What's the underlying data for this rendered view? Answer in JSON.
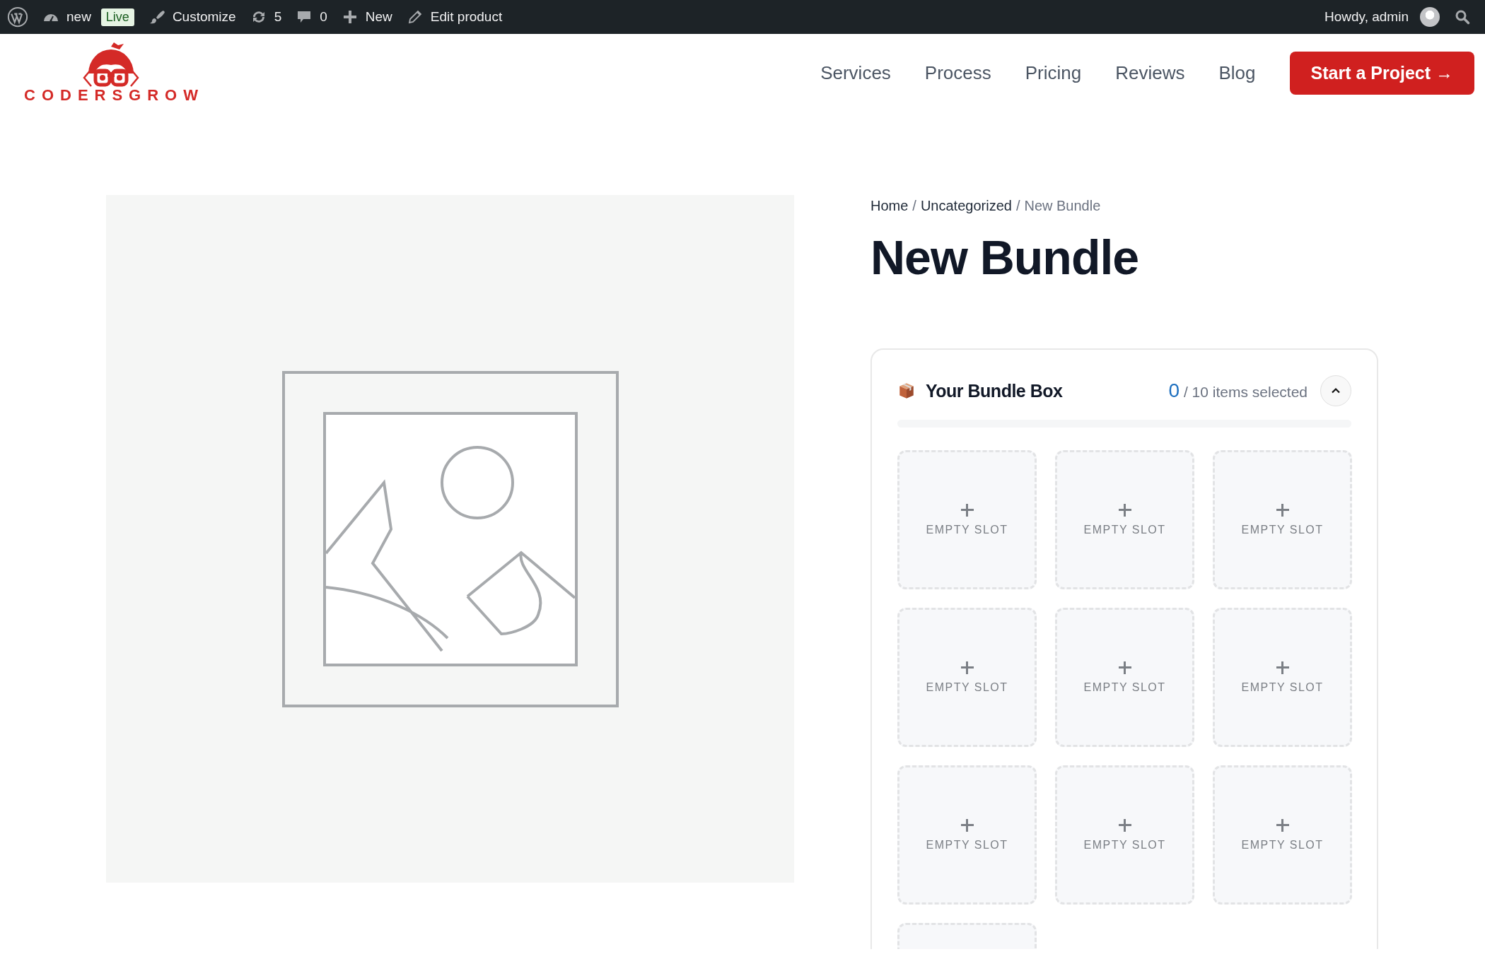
{
  "admin_bar": {
    "items": [
      {
        "kind": "wp-logo"
      },
      {
        "kind": "dashboard",
        "label": "new"
      },
      {
        "kind": "badge",
        "label": "Live"
      },
      {
        "kind": "brush",
        "label": "Customize"
      },
      {
        "kind": "updates",
        "label": "5"
      },
      {
        "kind": "comments",
        "label": "0"
      },
      {
        "kind": "plus",
        "label": "New"
      },
      {
        "kind": "pencil",
        "label": "Edit product"
      }
    ],
    "greeting": "Howdy, admin"
  },
  "header": {
    "logo_text": "CODERSGROW",
    "nav": [
      "Services",
      "Process",
      "Pricing",
      "Reviews",
      "Blog"
    ],
    "cta": "Start a Project →"
  },
  "product": {
    "image": {
      "kind": "placeholder"
    },
    "breadcrumb": [
      {
        "kind": "link",
        "label": "Home"
      },
      {
        "kind": "separator",
        "label": "/"
      },
      {
        "kind": "link",
        "label": "Uncategorized"
      },
      {
        "kind": "separator",
        "label": "/"
      },
      {
        "kind": "current",
        "label": "New Bundle"
      }
    ],
    "title": "New Bundle"
  },
  "bundle": {
    "title": "Your Bundle Box",
    "count": "0",
    "count_text": "/ 10 items selected",
    "expanded": true,
    "progress": {
      "level": 0
    },
    "slots": [
      {
        "kind": "empty",
        "label": "EMPTY SLOT"
      },
      {
        "kind": "empty",
        "label": "EMPTY SLOT"
      },
      {
        "kind": "empty",
        "label": "EMPTY SLOT"
      },
      {
        "kind": "empty",
        "label": "EMPTY SLOT"
      },
      {
        "kind": "empty",
        "label": "EMPTY SLOT"
      },
      {
        "kind": "empty",
        "label": "EMPTY SLOT"
      },
      {
        "kind": "empty",
        "label": "EMPTY SLOT"
      },
      {
        "kind": "empty",
        "label": "EMPTY SLOT"
      },
      {
        "kind": "empty",
        "label": "EMPTY SLOT"
      },
      {
        "kind": "empty"
      }
    ]
  }
}
